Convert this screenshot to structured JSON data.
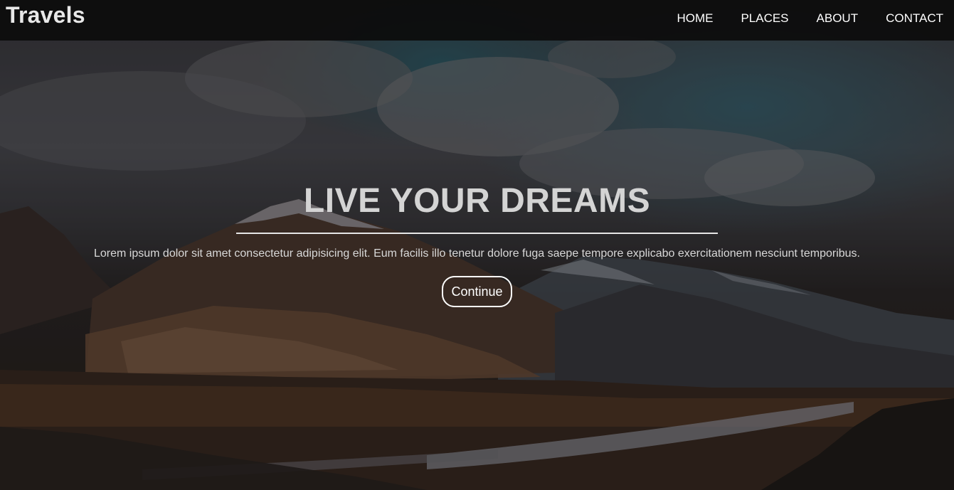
{
  "brand": {
    "title": "Travels"
  },
  "nav": {
    "items": [
      {
        "label": "HOME"
      },
      {
        "label": "PLACES"
      },
      {
        "label": "ABOUT"
      },
      {
        "label": "CONTACT"
      }
    ]
  },
  "hero": {
    "title": "LIVE YOUR DREAMS",
    "text": "Lorem ipsum dolor sit amet consectetur adipisicing elit. Eum facilis illo tenetur dolore fuga saepe tempore explicabo exercitationem nesciunt temporibus.",
    "button_label": "Continue",
    "background": "mountain-valley-landscape"
  },
  "colors": {
    "navbar": "#0c0c0c",
    "title": "#d4d4d4",
    "text": "#d8d8d8",
    "button_border": "#ffffff"
  }
}
